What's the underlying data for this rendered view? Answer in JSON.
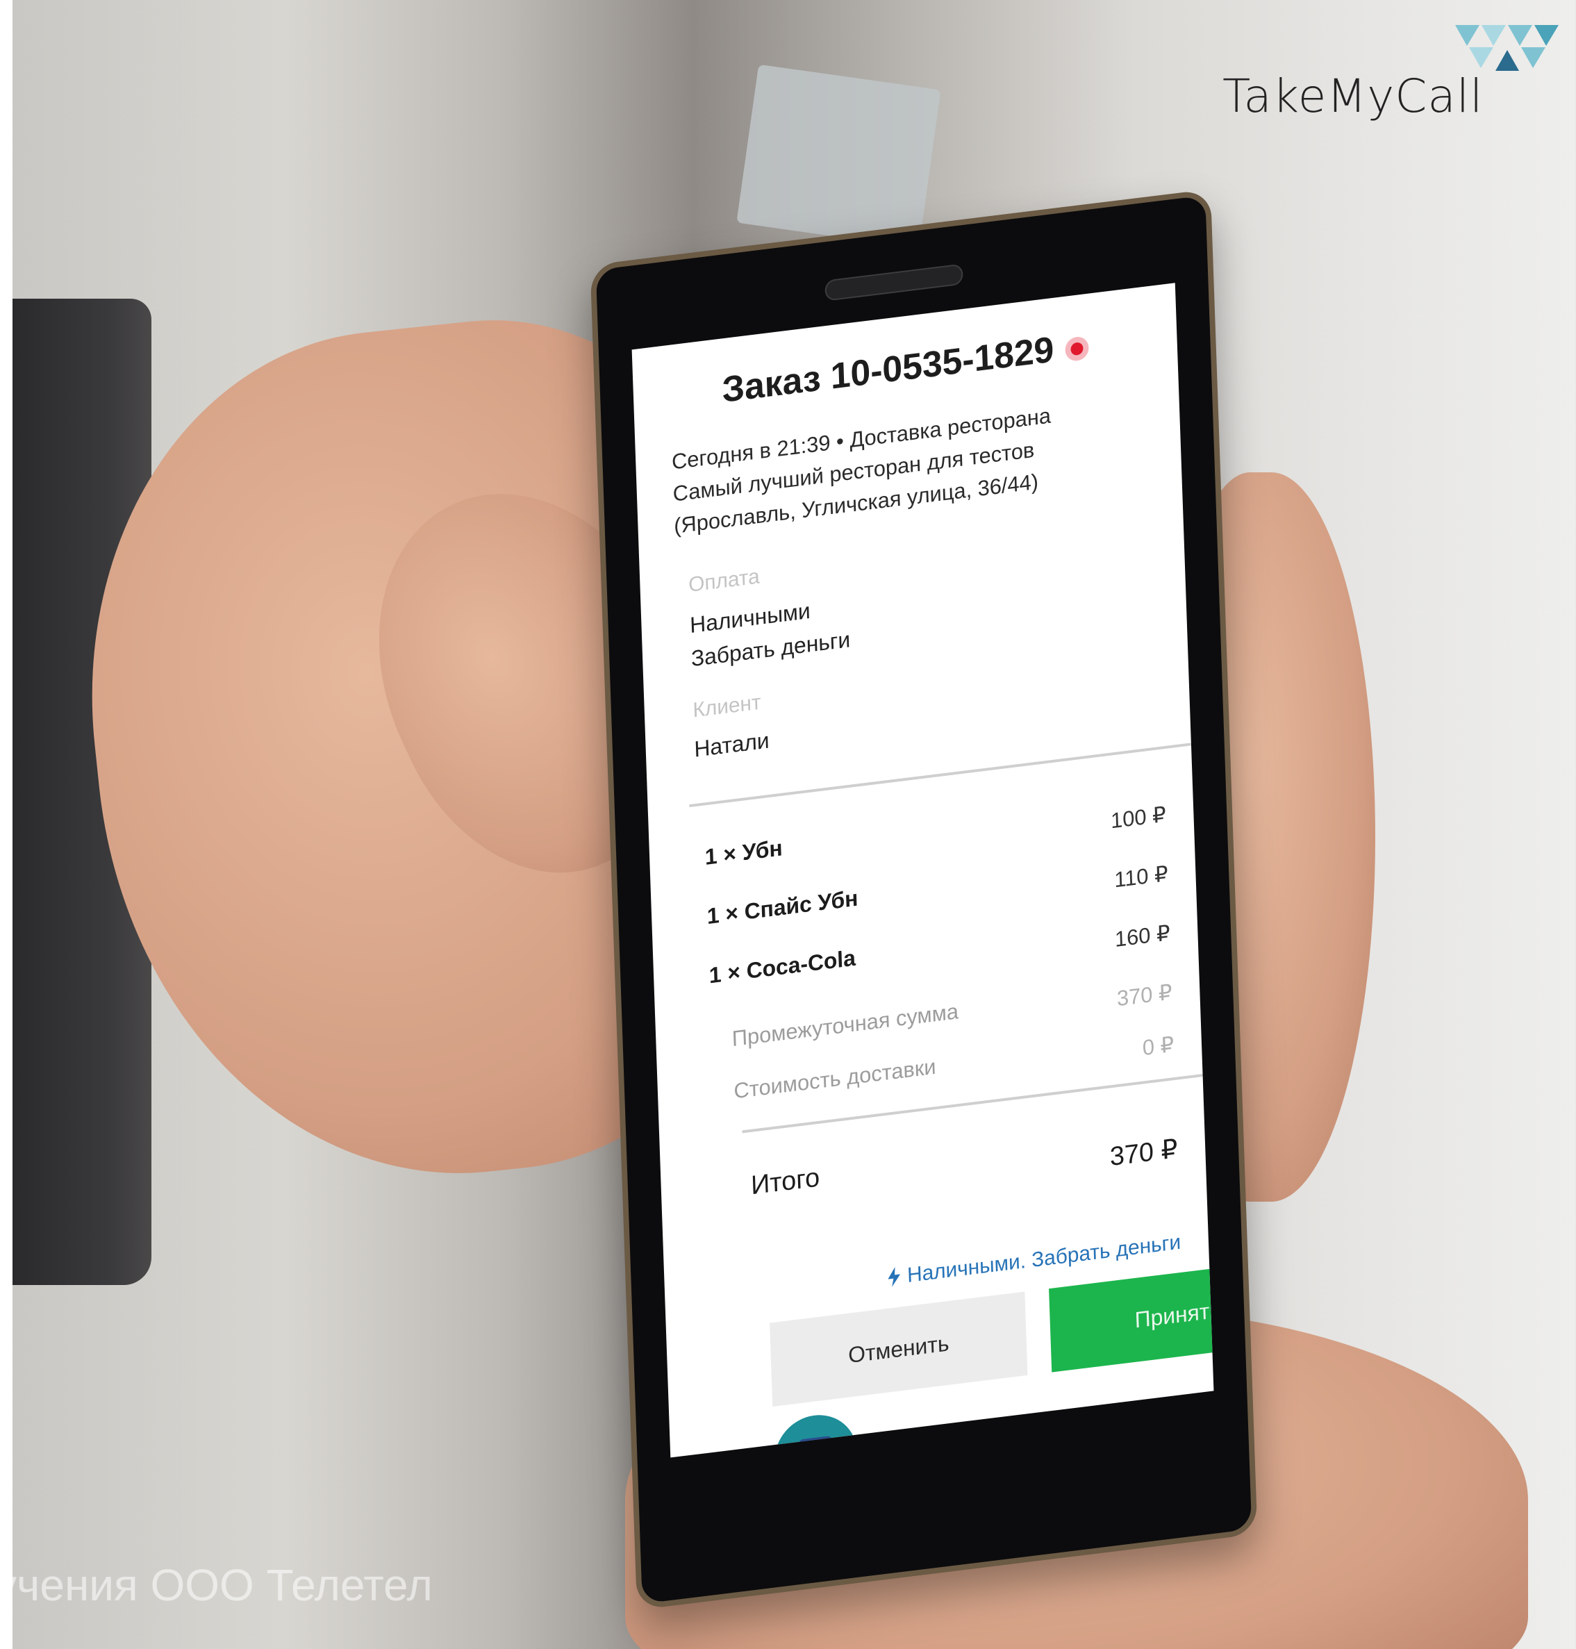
{
  "logo": {
    "text": "TakeMyCall",
    "mark_colors": [
      "#4aa3b8",
      "#7fc3d2",
      "#a9d8e2",
      "#2a6b8e"
    ]
  },
  "watermark": {
    "text": "учения ООО Телетел"
  },
  "order": {
    "title": "Заказ 10-0535-1829",
    "status_icon": "record-dot-icon",
    "time_line": "Сегодня в 21:39 • Доставка ресторана",
    "restaurant_line1": "Самый лучший ресторан для тестов",
    "restaurant_line2": "(Ярославль, Угличская улица, 36/44)"
  },
  "payment": {
    "label": "Оплата",
    "method": "Наличными",
    "action": "Забрать деньги"
  },
  "client": {
    "label": "Клиент",
    "name": "Натали"
  },
  "items": [
    {
      "name": "1 × Убн",
      "price": "100 ₽"
    },
    {
      "name": "1 × Спайс Убн",
      "price": "110 ₽"
    },
    {
      "name": "1 × Coca-Cola",
      "price": "160 ₽"
    }
  ],
  "summary": {
    "subtotal_label": "Промежуточная сумма",
    "subtotal_value": "370 ₽",
    "delivery_label": "Стоимость доставки",
    "delivery_value": "0 ₽",
    "total_label": "Итого",
    "total_value": "370 ₽",
    "payment_note": "Наличными. Забрать деньги"
  },
  "buttons": {
    "cancel": "Отменить",
    "accept": "Принять"
  },
  "colors": {
    "accept": "#1cb54d",
    "link": "#2773b7",
    "record": "#e0192d",
    "fab": "#1e8e98"
  }
}
